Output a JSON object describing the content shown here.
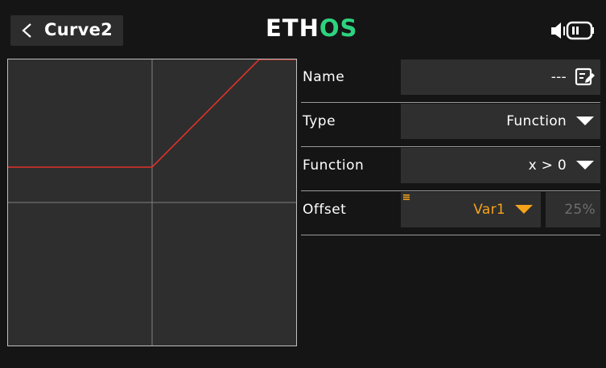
{
  "header": {
    "title": "Curve2",
    "logo_text_a": "ETH",
    "logo_text_b": "OS"
  },
  "form": {
    "name": {
      "label": "Name",
      "value": "---"
    },
    "type": {
      "label": "Type",
      "value": "Function"
    },
    "function": {
      "label": "Function",
      "value": "x > 0"
    },
    "offset": {
      "label": "Offset",
      "source": "Var1",
      "value": "25%"
    }
  },
  "colors": {
    "accent": "#f5a31a",
    "curve": "#e0322a",
    "logo_green": "#2dd37e"
  },
  "icons": [
    "chevron-left-icon",
    "edit-icon",
    "speaker-icon",
    "battery-icon",
    "dropdown-arrow-icon",
    "options-icon"
  ]
}
